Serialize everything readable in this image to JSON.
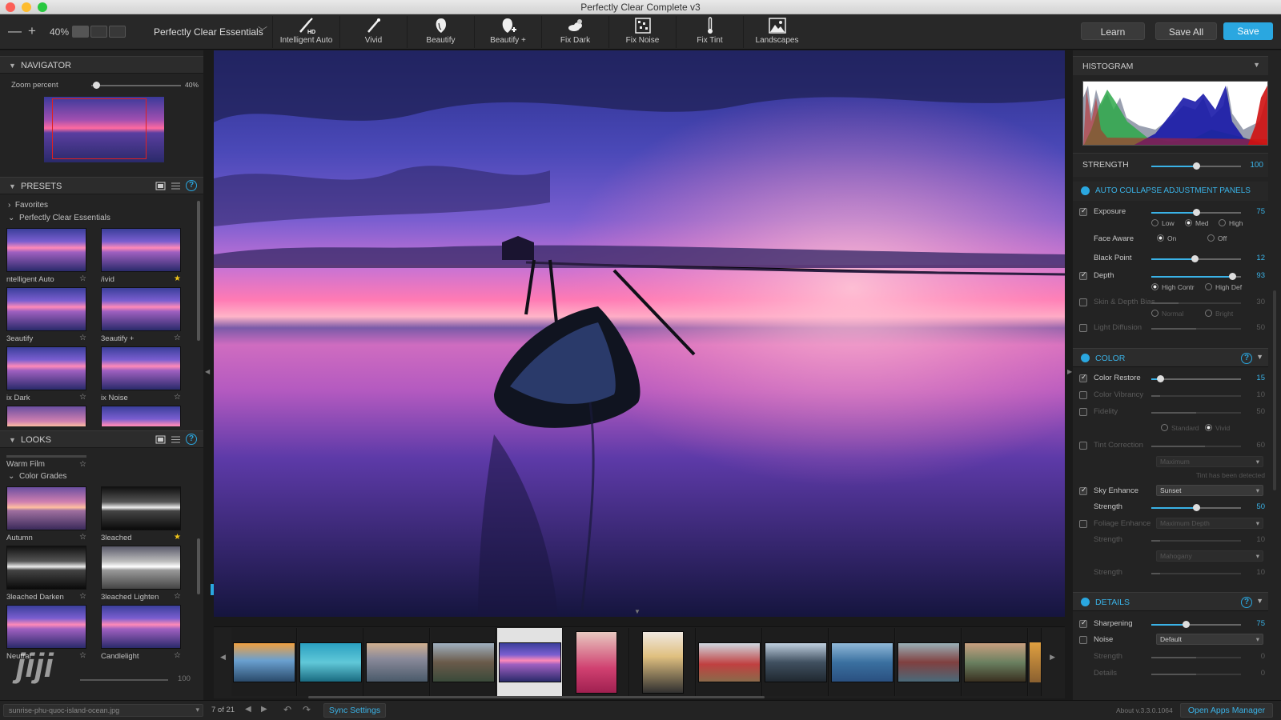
{
  "window": {
    "title": "Perfectly Clear Complete v3"
  },
  "toolbar": {
    "zoom_out": "—",
    "zoom_in": "+",
    "zoom_level": "40%",
    "preset_set": "Perfectly Clear Essentials",
    "tools": [
      {
        "label": "Intelligent Auto",
        "icon": "wand-hd-icon"
      },
      {
        "label": "Vivid",
        "icon": "wand-icon"
      },
      {
        "label": "Beautify",
        "icon": "face-icon"
      },
      {
        "label": "Beautify +",
        "icon": "face-plus-icon"
      },
      {
        "label": "Fix Dark",
        "icon": "cloud-sun-icon"
      },
      {
        "label": "Fix Noise",
        "icon": "noise-icon"
      },
      {
        "label": "Fix Tint",
        "icon": "thermometer-icon"
      },
      {
        "label": "Landscapes",
        "icon": "landscape-icon"
      }
    ],
    "learn": "Learn",
    "save_all": "Save All",
    "save": "Save",
    "accent": "#2aa7e0"
  },
  "navigator": {
    "title": "NAVIGATOR",
    "zoom_label": "Zoom percent",
    "zoom_value": "40%",
    "zoom_fraction": 0.05
  },
  "presets": {
    "title": "PRESETS",
    "favorites": "Favorites",
    "group": "Perfectly Clear Essentials",
    "items": [
      {
        "name": "ntelligent Auto",
        "star": false
      },
      {
        "name": "/ivid",
        "star": true
      },
      {
        "name": "3eautify",
        "star": false
      },
      {
        "name": "3eautify +",
        "star": false
      },
      {
        "name": "ix Dark",
        "star": false
      },
      {
        "name": "ix Noise",
        "star": false
      }
    ]
  },
  "looks": {
    "title": "LOOKS",
    "first": "Warm Film",
    "group": "Color Grades",
    "items": [
      {
        "name": "Autumn",
        "star": false
      },
      {
        "name": "3leached",
        "star": true
      },
      {
        "name": "3leached Darken",
        "star": false
      },
      {
        "name": "3leached Lighten",
        "star": false
      },
      {
        "name": "Neutral",
        "star": false
      },
      {
        "name": "Candlelight",
        "star": false
      }
    ],
    "footer_value": "100"
  },
  "histogram": {
    "title": "HISTOGRAM"
  },
  "strength": {
    "label": "STRENGTH",
    "value": "100",
    "fraction": 0.5
  },
  "auto_collapse": {
    "label": "AUTO COLLAPSE ADJUSTMENT PANELS"
  },
  "exposure": {
    "rows": [
      {
        "label": "Exposure",
        "value": "75",
        "checked": true,
        "fraction": 0.5
      },
      {
        "label": "Face Aware",
        "radios": [
          "On",
          "Off"
        ],
        "selected": 0
      },
      {
        "label": "Black Point",
        "value": "12",
        "fraction": 0.48
      },
      {
        "label": "Depth",
        "value": "93",
        "checked": true,
        "fraction": 0.9
      },
      {
        "label": "Skin & Depth Bias",
        "value": "30",
        "checked": false,
        "fraction": 0.3
      },
      {
        "label": "Light Diffusion",
        "value": "50",
        "checked": false,
        "fraction": 0.5
      }
    ],
    "levels": [
      "Low",
      "Med",
      "High"
    ],
    "depth_modes": [
      "High Contr",
      "High Def"
    ],
    "bias_modes": [
      "Normal",
      "Bright"
    ]
  },
  "color": {
    "title": "COLOR",
    "rows": [
      {
        "label": "Color Restore",
        "value": "15",
        "checked": true,
        "fraction": 0.1
      },
      {
        "label": "Color Vibrancy",
        "value": "10",
        "checked": false,
        "fraction": 0.1
      },
      {
        "label": "Fidelity",
        "value": "50",
        "checked": false,
        "fraction": 0.5
      },
      {
        "label": "Tint Correction",
        "value": "60",
        "checked": false,
        "fraction": 0.6
      },
      {
        "label": "Sky Enhance",
        "dropdown": "Sunset",
        "checked": true
      },
      {
        "label": "Strength",
        "value": "50",
        "fraction": 0.5
      },
      {
        "label": "Foliage Enhance",
        "dropdown": "Maximum Depth",
        "checked": false
      },
      {
        "label": "Strength",
        "value": "10",
        "fraction": 0.1
      },
      {
        "label": "Strength",
        "value": "10",
        "fraction": 0.1
      }
    ],
    "fidelity_modes": [
      "Standard",
      "Vivid"
    ],
    "tint_dropdown": "Maximum",
    "tint_note": "Tint has been detected",
    "extra_dropdown": "Mahogany"
  },
  "details": {
    "title": "DETAILS",
    "rows": [
      {
        "label": "Sharpening",
        "value": "75",
        "checked": true,
        "fraction": 0.38
      },
      {
        "label": "Noise",
        "dropdown": "Default",
        "checked": false
      },
      {
        "label": "Strength",
        "value": "0",
        "fraction": 0.5
      },
      {
        "label": "Details",
        "value": "0",
        "fraction": 0.5
      }
    ]
  },
  "filmstrip": {
    "count": 12,
    "selected": 4
  },
  "status": {
    "filename": "sunrise-phu-quoc-island-ocean.jpg",
    "position": "7 of 21",
    "sync": "Sync Settings",
    "version": "About v.3.3.0.1064",
    "open_apps": "Open Apps Manager"
  }
}
